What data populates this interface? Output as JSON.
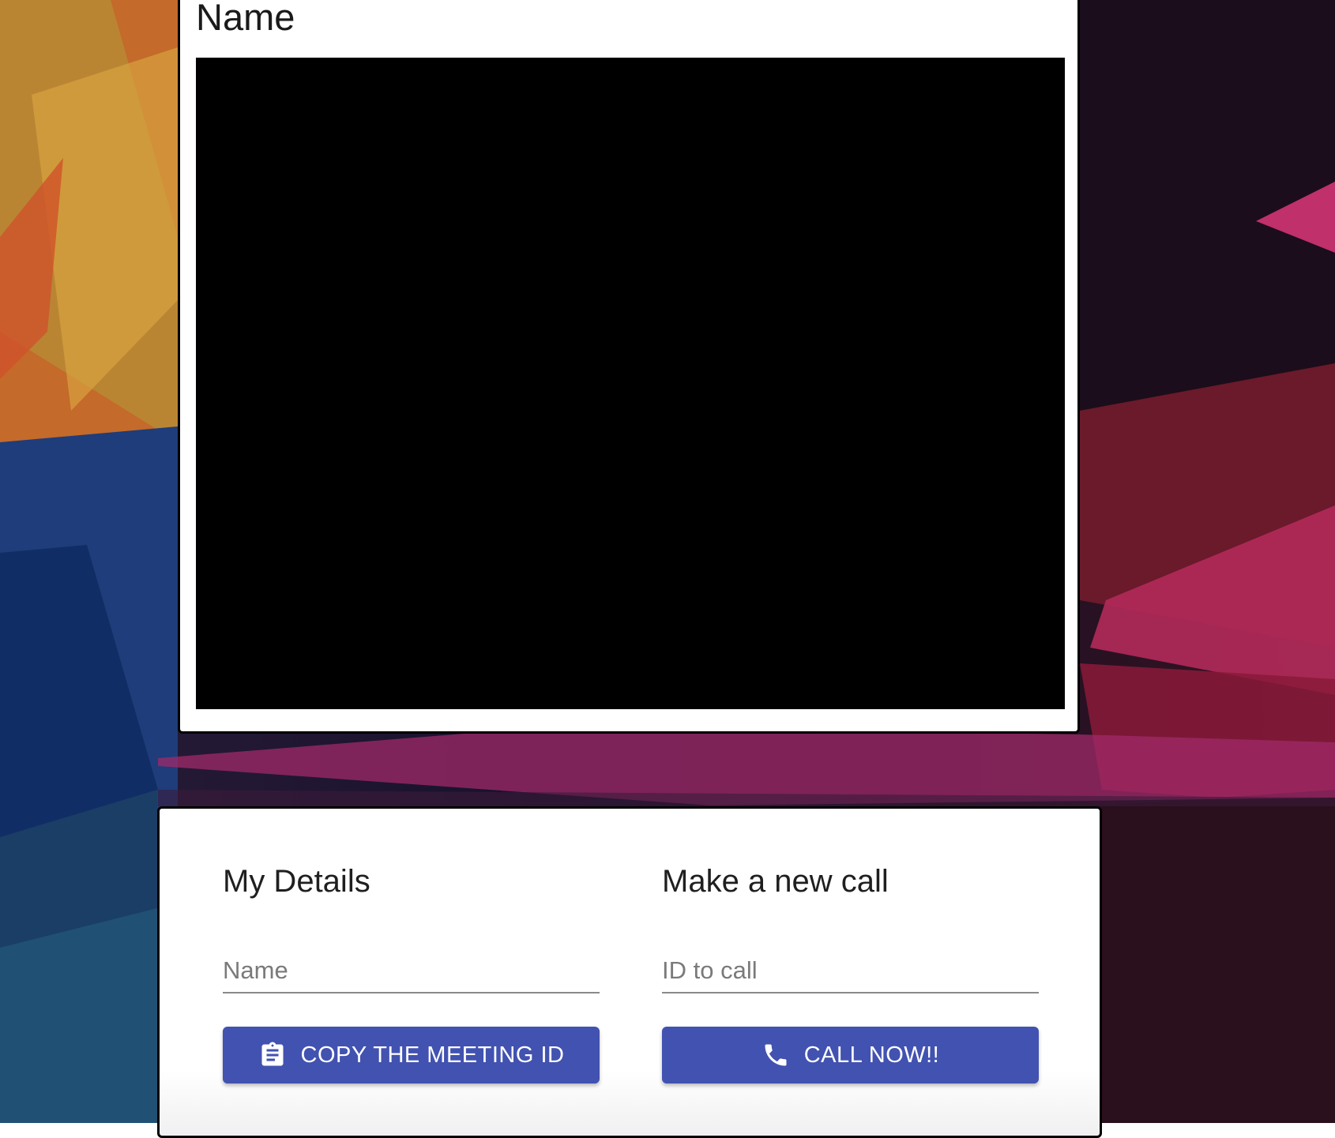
{
  "video": {
    "name": "Name"
  },
  "my_details": {
    "heading": "My Details",
    "name_placeholder": "Name",
    "copy_button_label": "COPY THE MEETING ID",
    "copy_icon": "clipboard-icon"
  },
  "new_call": {
    "heading": "Make a new call",
    "id_placeholder": "ID to call",
    "call_button_label": "CALL NOW!!",
    "call_icon": "phone-icon"
  },
  "colors": {
    "button": "#4252b0",
    "card": "#ffffff",
    "video": "#000000"
  }
}
